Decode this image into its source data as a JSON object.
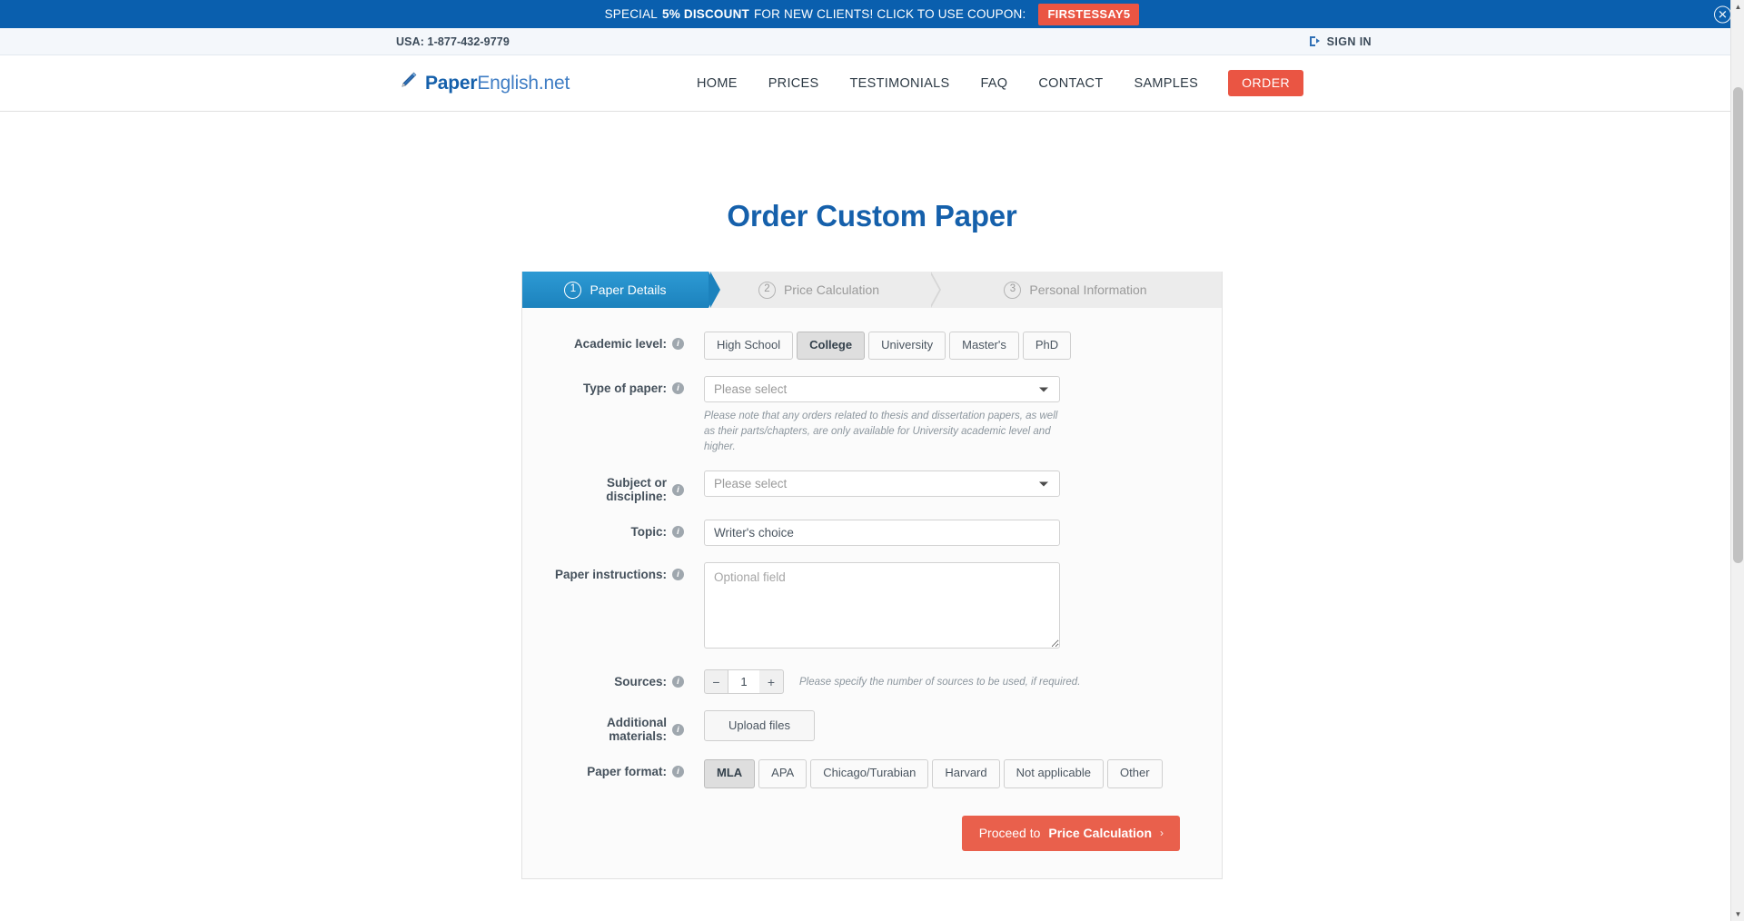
{
  "promo": {
    "prefix": "SPECIAL",
    "highlight": "5% DISCOUNT",
    "suffix": "FOR NEW CLIENTS! CLICK TO USE COUPON:",
    "coupon": "FIRSTESSAY5",
    "close_glyph": "✕",
    "bg_color": "#0a5fae",
    "coupon_color": "#ea5543"
  },
  "utility": {
    "phone": "USA: 1-877-432-9779",
    "sign_in": "SIGN IN"
  },
  "header": {
    "logo_bold": "Paper",
    "logo_rest": "English.net",
    "nav": [
      {
        "label": "HOME"
      },
      {
        "label": "PRICES"
      },
      {
        "label": "TESTIMONIALS"
      },
      {
        "label": "FAQ"
      },
      {
        "label": "CONTACT"
      },
      {
        "label": "SAMPLES"
      }
    ],
    "order_label": "ORDER"
  },
  "page": {
    "title": "Order Custom Paper"
  },
  "steps": [
    {
      "num": "1",
      "label": "Paper Details",
      "active": true
    },
    {
      "num": "2",
      "label": "Price Calculation",
      "active": false
    },
    {
      "num": "3",
      "label": "Personal Information",
      "active": false
    }
  ],
  "form": {
    "academic_level": {
      "label": "Academic level:",
      "options": [
        "High School",
        "College",
        "University",
        "Master's",
        "PhD"
      ],
      "selected": "College"
    },
    "type_of_paper": {
      "label": "Type of paper:",
      "value": "Please select",
      "note": "Please note that any orders related to thesis and dissertation papers, as well as their parts/chapters, are only available for University academic level and higher."
    },
    "subject": {
      "label": "Subject or discipline:",
      "value": "Please select"
    },
    "topic": {
      "label": "Topic:",
      "value": "Writer's choice"
    },
    "instructions": {
      "label": "Paper instructions:",
      "placeholder": "Optional field",
      "value": ""
    },
    "sources": {
      "label": "Sources:",
      "minus": "−",
      "plus": "+",
      "value": "1",
      "hint": "Please specify the number of sources to be used, if required."
    },
    "additional_materials": {
      "label": "Additional materials:",
      "upload_label": "Upload files"
    },
    "paper_format": {
      "label": "Paper format:",
      "options": [
        "MLA",
        "APA",
        "Chicago/Turabian",
        "Harvard",
        "Not applicable",
        "Other"
      ],
      "selected": "MLA"
    },
    "proceed": {
      "prefix": "Proceed to",
      "bold": "Price Calculation",
      "chevron": "›"
    },
    "info_glyph": "i"
  }
}
